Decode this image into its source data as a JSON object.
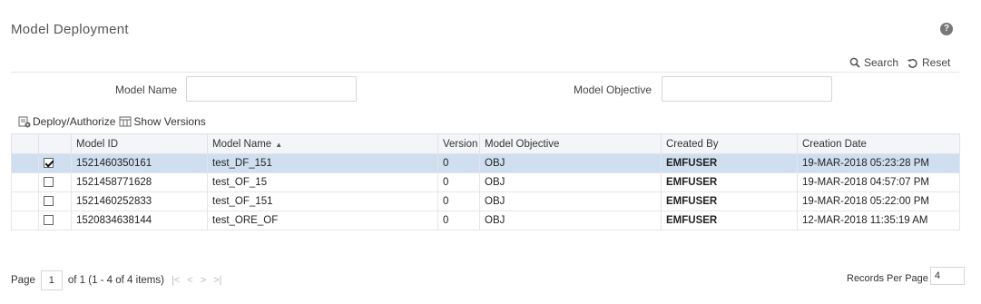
{
  "page": {
    "title": "Model Deployment"
  },
  "help": {
    "glyph": "?"
  },
  "search_bar": {
    "search_label": "Search",
    "reset_label": "Reset"
  },
  "filters": {
    "model_name_label": "Model Name",
    "model_name_value": "",
    "model_objective_label": "Model Objective",
    "model_objective_value": ""
  },
  "toolbar": {
    "deploy_label": "Deploy/Authorize",
    "versions_label": "Show Versions"
  },
  "table": {
    "columns": [
      "",
      "Model ID",
      "Model Name",
      "Version",
      "Model Objective",
      "Created By",
      "Creation Date"
    ],
    "rows": [
      {
        "checked": true,
        "model_id": "1521460350161",
        "model_name": "test_DF_151",
        "version": "0",
        "objective": "OBJ",
        "created_by": "EMFUSER",
        "creation_date": "19-MAR-2018 05:23:28 PM"
      },
      {
        "checked": false,
        "model_id": "1521458771628",
        "model_name": "test_OF_15",
        "version": "0",
        "objective": "OBJ",
        "created_by": "EMFUSER",
        "creation_date": "19-MAR-2018 04:57:07 PM"
      },
      {
        "checked": false,
        "model_id": "1521460252833",
        "model_name": "test_OF_151",
        "version": "0",
        "objective": "OBJ",
        "created_by": "EMFUSER",
        "creation_date": "19-MAR-2018 05:22:00 PM"
      },
      {
        "checked": false,
        "model_id": "1520834638144",
        "model_name": "test_ORE_OF",
        "version": "0",
        "objective": "OBJ",
        "created_by": "EMFUSER",
        "creation_date": "12-MAR-2018 11:35:19 AM"
      }
    ]
  },
  "pagination": {
    "page_label": "Page",
    "current_page": "1",
    "summary": "of 1 (1 - 4 of 4 items)",
    "records_per_page_label": "Records Per Page",
    "records_per_page": "4"
  },
  "colors": {
    "selected_row": "#cfdff0",
    "header_bg": "#f3f5f8"
  }
}
